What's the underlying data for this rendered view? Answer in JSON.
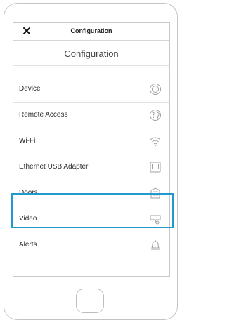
{
  "topbar": {
    "title": "Configuration",
    "close_icon": "close-icon"
  },
  "page": {
    "heading": "Configuration"
  },
  "menu": [
    {
      "label": "Device",
      "icon": "device-icon"
    },
    {
      "label": "Remote Access",
      "icon": "globe-icon"
    },
    {
      "label": "Wi-Fi",
      "icon": "wifi-icon"
    },
    {
      "label": "Ethernet USB Adapter",
      "icon": "ethernet-icon"
    },
    {
      "label": "Doors",
      "icon": "door-icon",
      "highlighted": true
    },
    {
      "label": "Video",
      "icon": "video-icon"
    },
    {
      "label": "Alerts",
      "icon": "bell-icon"
    }
  ],
  "colors": {
    "highlight": "#2199cc",
    "icon": "#a0a0a0",
    "text": "#2a2a2a"
  }
}
